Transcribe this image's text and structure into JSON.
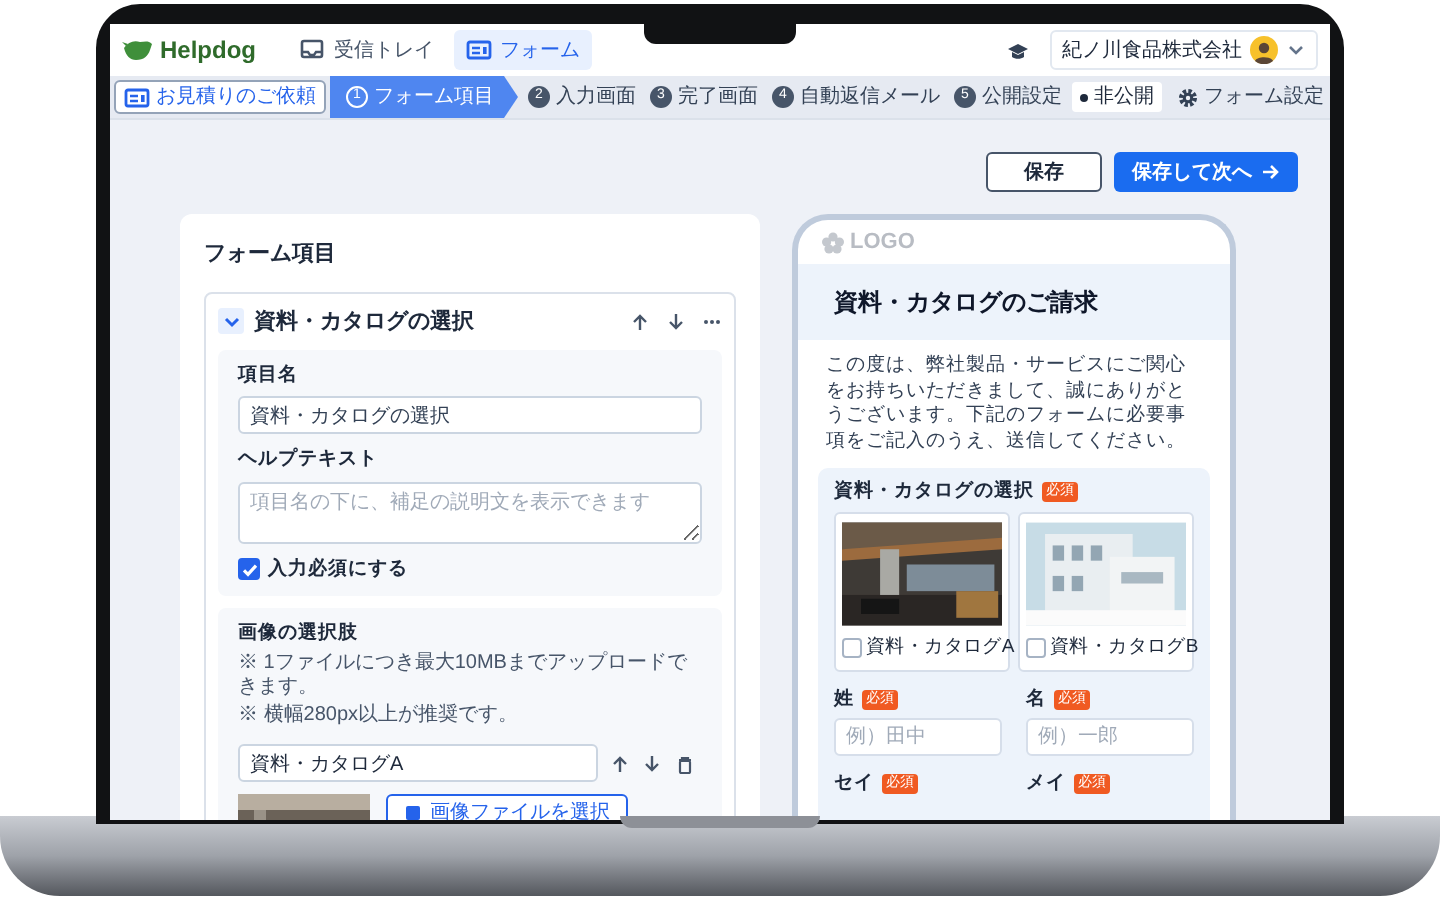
{
  "app_bar": {
    "logo": "Helpdog",
    "nav": [
      {
        "label": "受信トレイ",
        "selected": false
      },
      {
        "label": "フォーム",
        "selected": true
      }
    ],
    "company": "紀ノ川食品株式会社"
  },
  "step_bar": {
    "form_button": "お見積りのご依頼",
    "steps": [
      {
        "number": "1",
        "label": "フォーム項目",
        "selected": true
      },
      {
        "number": "2",
        "label": "入力画面",
        "selected": false
      },
      {
        "number": "3",
        "label": "完了画面",
        "selected": false
      },
      {
        "number": "4",
        "label": "自動返信メール",
        "selected": false
      },
      {
        "number": "5",
        "label": "公開設定",
        "selected": false
      }
    ],
    "visibility": "非公開",
    "settings": "フォーム設定"
  },
  "actions": [
    {
      "label": "保存",
      "kind": "secondary"
    },
    {
      "label": "保存して次へ",
      "kind": "primary"
    }
  ],
  "editor": {
    "title": "フォーム項目",
    "item": {
      "title": "資料・カタログの選択",
      "expanded": true,
      "name_label": "項目名",
      "name_value": "資料・カタログの選択",
      "help_label": "ヘルプテキスト",
      "help_placeholder": "項目名の下に、補足の説明文を表示できます",
      "required_label": "入力必須にする",
      "required": true,
      "choices": {
        "title": "画像の選択肢",
        "notes": [
          "※ 1ファイルにつき最大10MBまでアップロードできます。",
          "※ 横幅280px以上が推奨です。"
        ],
        "options": [
          {
            "value": "資料・カタログA",
            "file_button": "画像ファイルを選択"
          }
        ]
      }
    }
  },
  "preview": {
    "logo": "LOGO",
    "title": "資料・カタログのご請求",
    "intro": "この度は、弊社製品・サービスにご関心をお持ちいただきまして、誠にありがとうございます。下記のフォームに必要事項をご記入のうえ、送信してください。",
    "catalog": {
      "label": "資料・カタログの選択",
      "required_badge": "必須",
      "options": [
        {
          "label": "資料・カタログA",
          "checked": false
        },
        {
          "label": "資料・カタログB",
          "checked": false
        }
      ]
    },
    "name_fields": [
      {
        "label": "姓",
        "required_badge": "必須",
        "placeholder": "例）田中"
      },
      {
        "label": "名",
        "required_badge": "必須",
        "placeholder": "例）一郎"
      }
    ],
    "kana_fields": [
      {
        "label": "セイ",
        "required_badge": "必須"
      },
      {
        "label": "メイ",
        "required_badge": "必須"
      }
    ]
  }
}
